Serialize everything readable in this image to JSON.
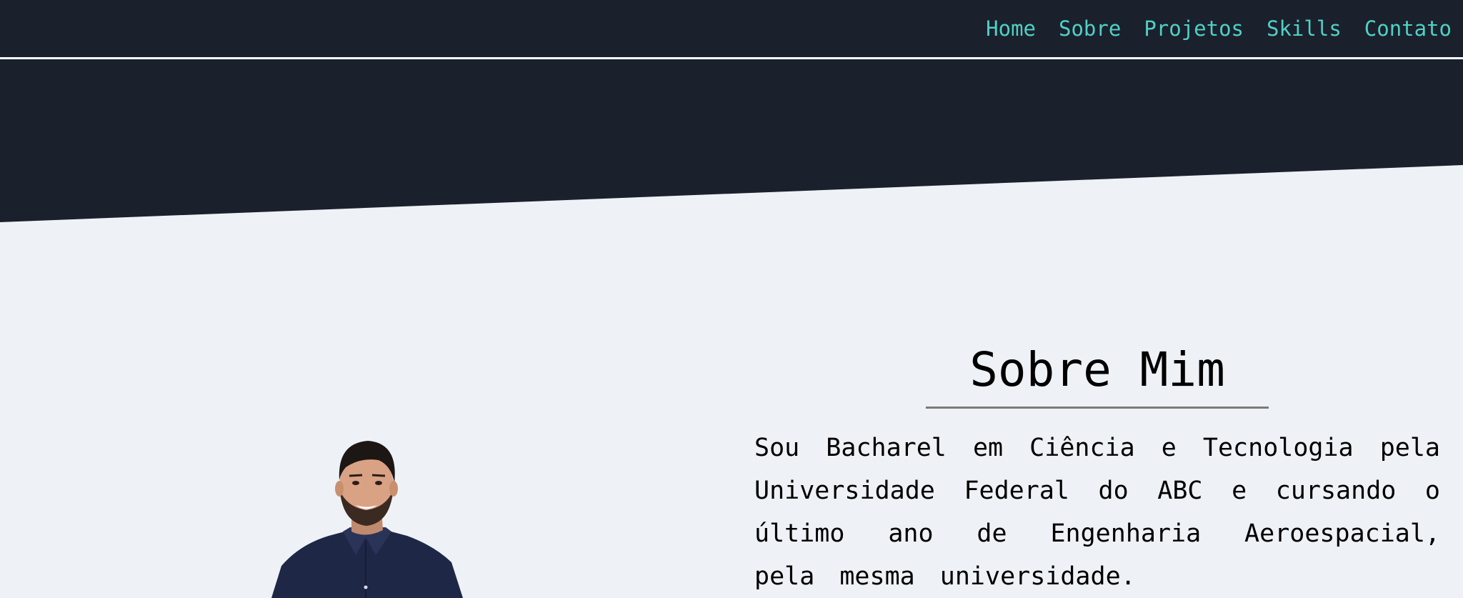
{
  "nav": {
    "items": [
      {
        "label": "Home"
      },
      {
        "label": "Sobre"
      },
      {
        "label": "Projetos"
      },
      {
        "label": "Skills"
      },
      {
        "label": "Contato"
      }
    ]
  },
  "about": {
    "title": "Sobre Mim",
    "text": "Sou Bacharel em Ciência e Tecnologia pela Universidade Federal do ABC e cursando o último ano de Engenharia Aeroespacial, pela mesma universidade."
  },
  "colors": {
    "header_bg": "#1b202d",
    "nav_link": "#4fd1c5",
    "page_bg": "#eef2f6",
    "divider": "#ffffff",
    "title_underline": "#7a7a7a"
  },
  "icons": {
    "portrait": "profile-photo"
  }
}
